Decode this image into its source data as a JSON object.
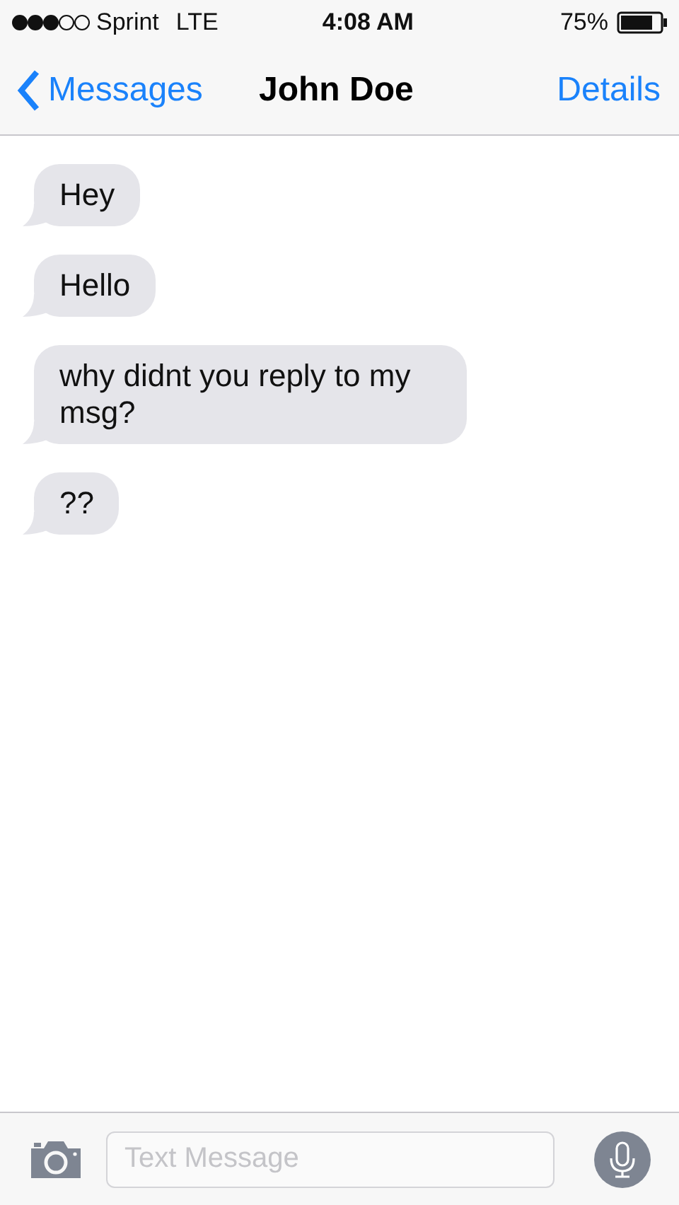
{
  "status_bar": {
    "carrier": "Sprint",
    "network": "LTE",
    "time": "4:08 AM",
    "battery": "75%"
  },
  "nav_bar": {
    "back": "Messages",
    "title": "John Doe",
    "action": "Details"
  },
  "messages": [
    {
      "text": "Hey"
    },
    {
      "text": "Hello"
    },
    {
      "text": "why didnt you reply to my msg?"
    },
    {
      "text": "??"
    }
  ],
  "composer": {
    "placeholder": "Text Message"
  }
}
